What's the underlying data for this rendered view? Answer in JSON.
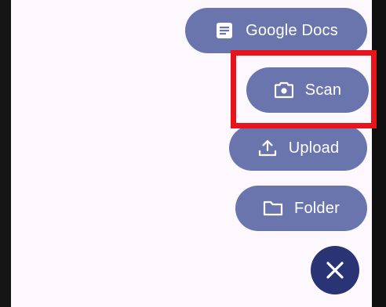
{
  "speed_dial": {
    "actions": [
      {
        "label": "Google Docs",
        "icon": "google-docs-icon"
      },
      {
        "label": "Scan",
        "icon": "camera-icon"
      },
      {
        "label": "Upload",
        "icon": "upload-icon"
      },
      {
        "label": "Folder",
        "icon": "folder-icon"
      }
    ],
    "close_icon": "close-icon"
  },
  "colors": {
    "action_bg": "#6b75ad",
    "close_fab_bg": "#2a3474",
    "highlight": "#e8141b",
    "screen_bg": "#fcf8fd"
  }
}
